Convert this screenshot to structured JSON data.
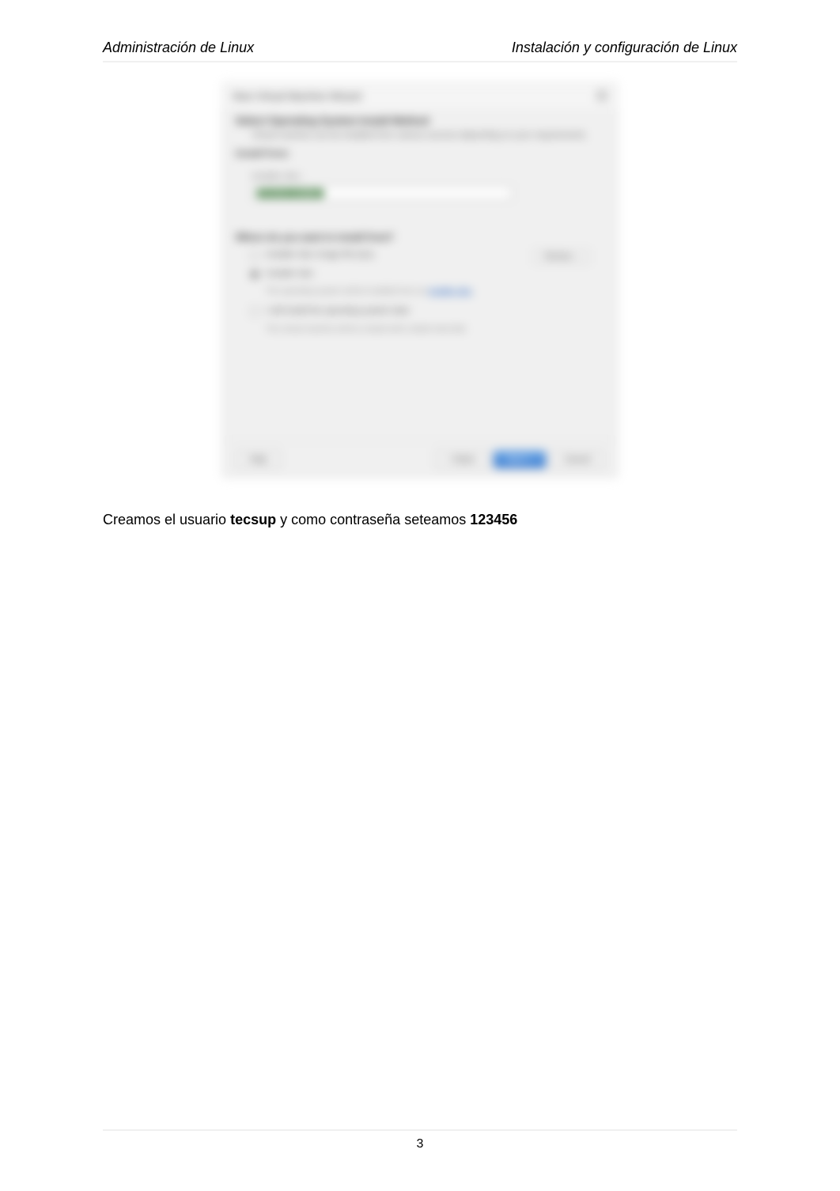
{
  "header": {
    "left": "Administración de Linux",
    "right": "Instalación y configuración de Linux"
  },
  "wizard": {
    "title": "New Virtual Machine Wizard",
    "heading": "Select Operating System Install Method",
    "subtext": "Virtual machine can be installed from various sources depending on your requirements.",
    "section_label": "Install from:",
    "disc_label": "Installer disc:",
    "disc_value": "No drives available",
    "options_title": "Where do you want to install from?",
    "option1": "Installer disc image file (iso):",
    "browse": "Browse...",
    "option2": "Installer disc",
    "option2_sub": "The operating system will be installed from an ",
    "option2_link": "installer disc",
    "option3": "I will install the operating system later",
    "option3_sub": "The virtual machine will be created with a blank hard disk",
    "buttons": {
      "help": "Help",
      "back": "< Back",
      "next": "Next >",
      "cancel": "Cancel"
    }
  },
  "body": {
    "text_before": "Creamos el usuario ",
    "user": "tecsup",
    "text_mid": " y como contraseña seteamos ",
    "password": "123456"
  },
  "footer": {
    "page_number": "3"
  }
}
